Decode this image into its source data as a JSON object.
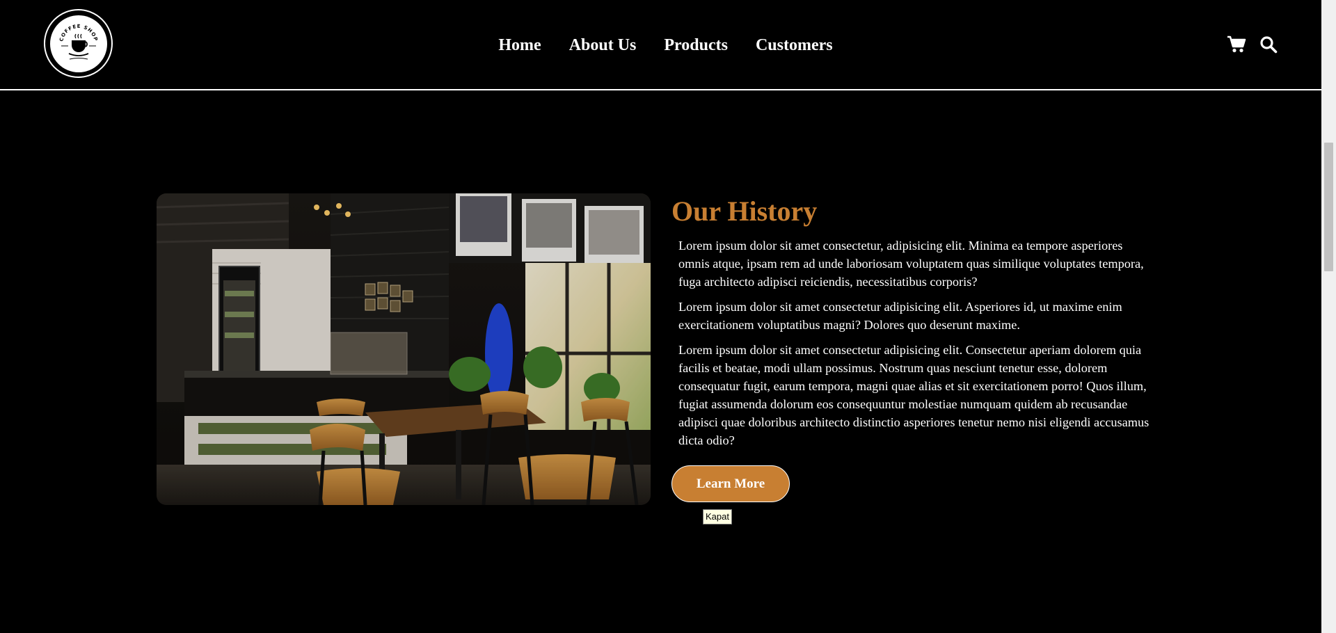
{
  "header": {
    "logo_text": "COFFEE SHOP",
    "nav": [
      {
        "label": "Home"
      },
      {
        "label": "About Us"
      },
      {
        "label": "Products"
      },
      {
        "label": "Customers"
      }
    ],
    "icons": [
      "cart-icon",
      "search-icon"
    ]
  },
  "history": {
    "title": "Our History",
    "paragraphs": [
      "Lorem ipsum dolor sit amet consectetur, adipisicing elit. Minima ea tempore asperiores omnis atque, ipsam rem ad unde laboriosam voluptatem quas similique voluptates tempora, fuga architecto adipisci reiciendis, necessitatibus corporis?",
      "Lorem ipsum dolor sit amet consectetur adipisicing elit. Asperiores id, ut maxime enim exercitationem voluptatibus magni? Dolores quo deserunt maxime.",
      "Lorem ipsum dolor sit amet consectetur adipisicing elit. Consectetur aperiam dolorem quia facilis et beatae, modi ullam possimus. Nostrum quas nesciunt tenetur esse, dolorem consequatur fugit, earum tempora, magni quae alias et sit exercitationem porro! Quos illum, fugiat assumenda dolorum eos consequuntur molestiae numquam quidem ab recusandae adipisci quae doloribus architecto distinctio asperiores tenetur nemo nisi eligendi accusamus dicta odio?"
    ],
    "button_label": "Learn More",
    "tooltip": "Kapat"
  },
  "colors": {
    "accent": "#c87f32",
    "background": "#000000",
    "text": "#ffffff"
  }
}
